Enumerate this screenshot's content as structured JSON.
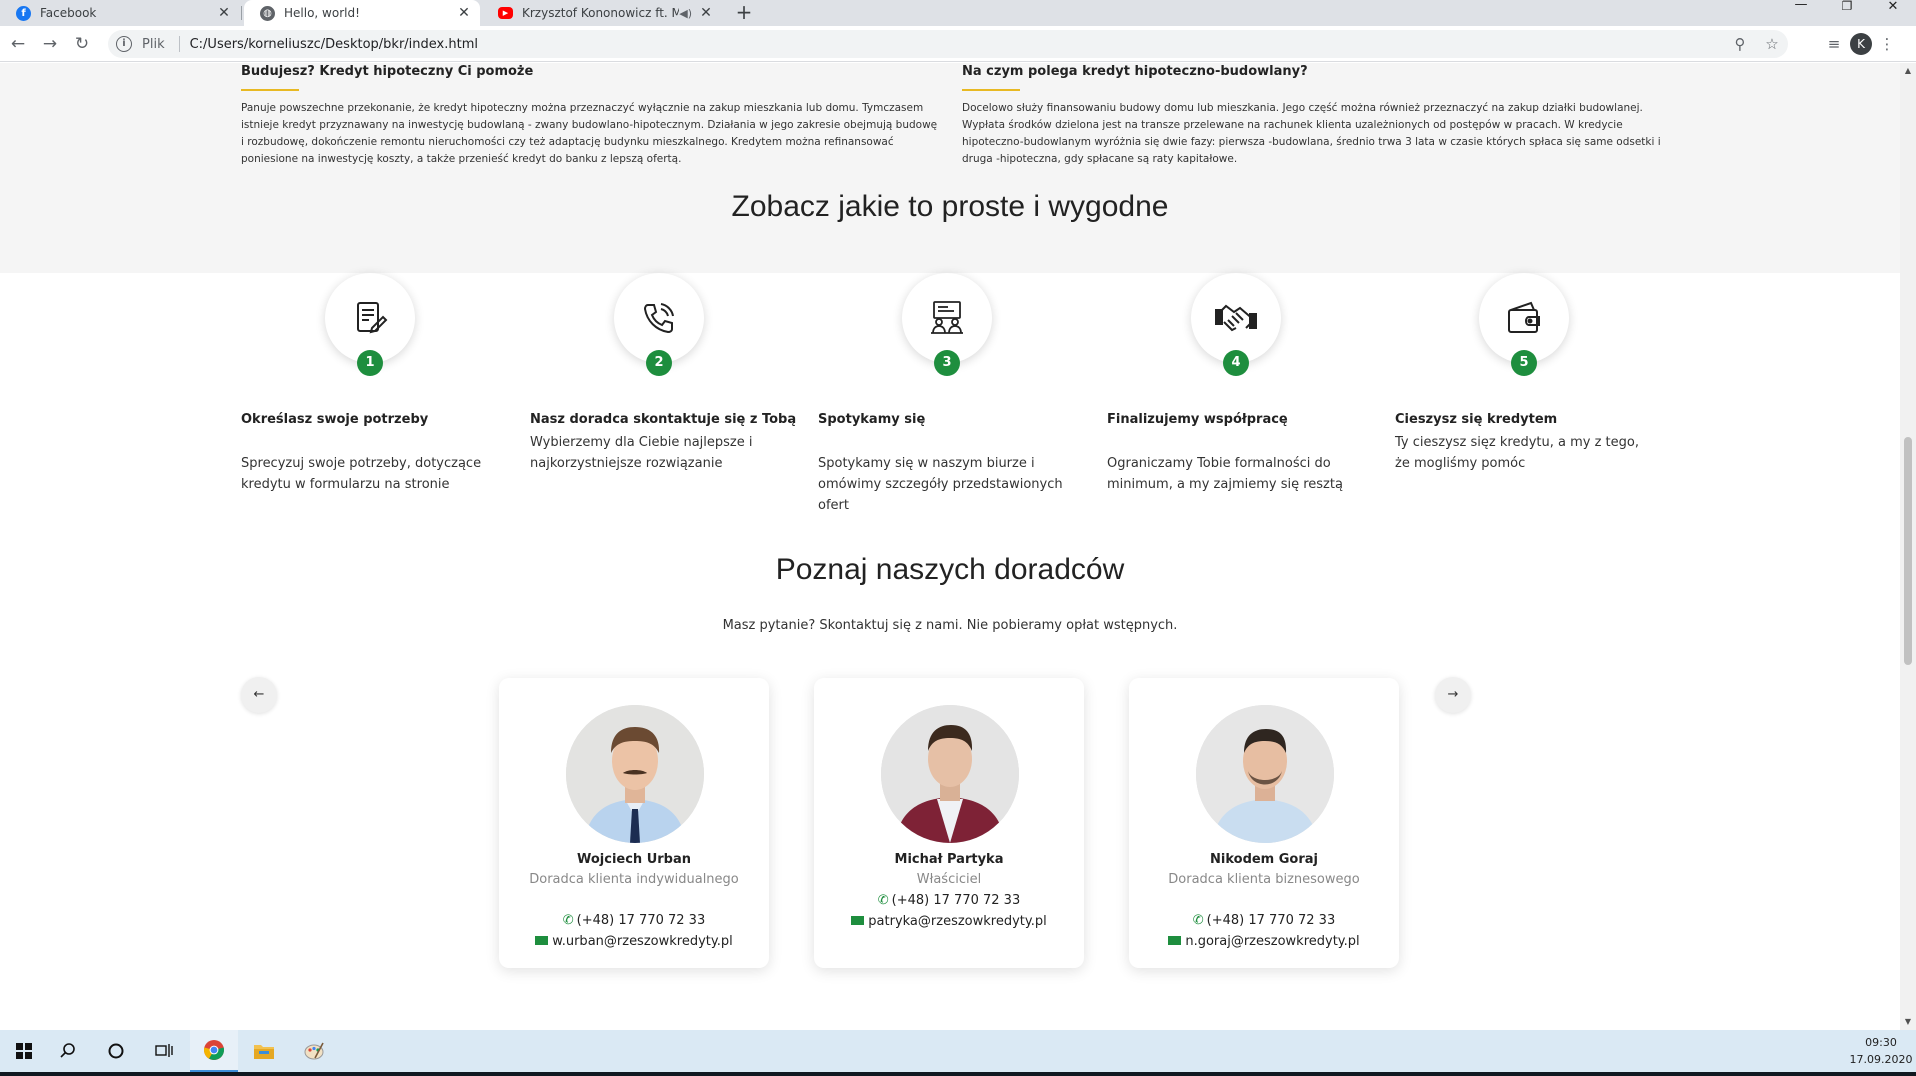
{
  "browser": {
    "tabs": [
      {
        "label": "Facebook",
        "favicon": "facebook-icon",
        "color": "#1877f2"
      },
      {
        "label": "Hello, world!",
        "favicon": "globe-icon",
        "color": "#5f6368"
      },
      {
        "label": "Krzysztof Kononowicz ft. Ma",
        "favicon": "youtube-icon",
        "color": "#ff0000"
      }
    ],
    "address": {
      "scheme": "Plik",
      "url": "C:/Users/korneliuszc/Desktop/bkr/index.html"
    },
    "profile_initial": "K"
  },
  "info": {
    "left": {
      "title": "Budujesz? Kredyt hipoteczny Ci pomoże",
      "text": "Panuje powszechne przekonanie, że kredyt hipoteczny można przeznaczyć wyłącznie na zakup mieszkania lub domu. Tymczasem istnieje kredyt przyznawany na inwestycję budowlaną - zwany budowlano-hipotecznym. Działania w jego zakresie obejmują budowę i rozbudowę, dokończenie remontu nieruchomości czy też adaptację budynku mieszkalnego. Kredytem można refinansować poniesione na inwestycję koszty, a także przenieść kredyt do banku z lepszą ofertą."
    },
    "right": {
      "title": "Na czym polega kredyt hipoteczno-budowlany?",
      "text": "Docelowo służy finansowaniu budowy domu lub mieszkania. Jego część można również przeznaczyć na zakup działki budowlanej. Wypłata środków dzielona jest na transze przelewane na rachunek klienta uzależnionych od postępów w pracach. W kredycie hipoteczno-budowlanym wyróżnia się dwie fazy: pierwsza -budowlana, średnio trwa 3 lata w czasie których spłaca się same odsetki i druga -hipoteczna, gdy spłacane są raty kapitałowe."
    },
    "accent": "#e8b923"
  },
  "steps": {
    "heading": "Zobacz jakie to proste i wygodne",
    "items": [
      {
        "num": "1",
        "icon": "document-edit-icon",
        "title": "Określasz swoje potrzeby",
        "text": "Sprecyzuj swoje potrzeby, dotyczące kredytu w formularzu na stronie"
      },
      {
        "num": "2",
        "icon": "phone-call-icon",
        "title": "Nasz doradca skontaktuje się z Tobą",
        "text": "Wybierzemy dla Ciebie najlepsze i najkorzystniejsze rozwiązanie"
      },
      {
        "num": "3",
        "icon": "meeting-icon",
        "title": "Spotykamy się",
        "text": "Spotykamy się w naszym biurze i omówimy szczegóły przedstawionych ofert"
      },
      {
        "num": "4",
        "icon": "handshake-icon",
        "title": "Finalizujemy współpracę",
        "text": "Ograniczamy Tobie formalności do minimum, a my zajmiemy się resztą"
      },
      {
        "num": "5",
        "icon": "wallet-icon",
        "title": "Cieszysz się kredytem",
        "text": "Ty cieszysz sięz kredytu, a my z tego, że mogliśmy pomóc"
      }
    ],
    "badge_color": "#1e8e3e"
  },
  "advisors": {
    "heading": "Poznaj naszych doradców",
    "subheading": "Masz pytanie? Skontaktuj się z nami. Nie pobieramy opłat wstępnych.",
    "cards": [
      {
        "name": "Wojciech Urban",
        "role": "Doradca klienta indywidualnego",
        "phone": "(+48) 17 770 72 33",
        "email": "w.urban@rzeszowkredyty.pl"
      },
      {
        "name": "Michał Partyka",
        "role": "Właściciel",
        "phone": "(+48) 17 770 72 33",
        "email": "patryka@rzeszowkredyty.pl"
      },
      {
        "name": "Nikodem Goraj",
        "role": "Doradca klienta biznesowego",
        "phone": "(+48) 17 770 72 33",
        "email": "n.goraj@rzeszowkredyty.pl"
      }
    ],
    "prev_icon": "arrow-left-icon",
    "next_icon": "arrow-right-icon"
  },
  "taskbar": {
    "time": "09:30",
    "date": "17.09.2020"
  }
}
